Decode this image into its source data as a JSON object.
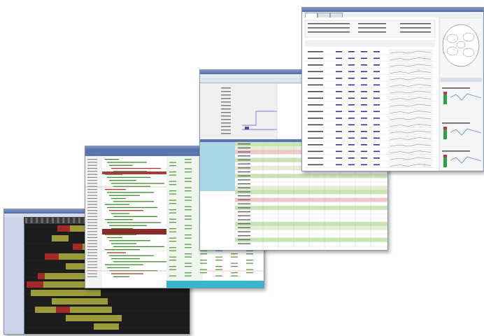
{
  "colors": {
    "title_bar": "#5b74ad",
    "dark_grid": "#1e1e1e",
    "olive_bar": "#9b9b3c",
    "red_bar": "#a32828",
    "code_green": "#3c8a2a",
    "highlight_blue": "#9fd3e6",
    "row_green": "#c8e6b4",
    "row_pink": "#f0c8c8",
    "link_purple": "#3a2ca8"
  },
  "window4": {
    "tabs": [],
    "status_label": "",
    "sidebar_caption": "",
    "section_labels": []
  }
}
